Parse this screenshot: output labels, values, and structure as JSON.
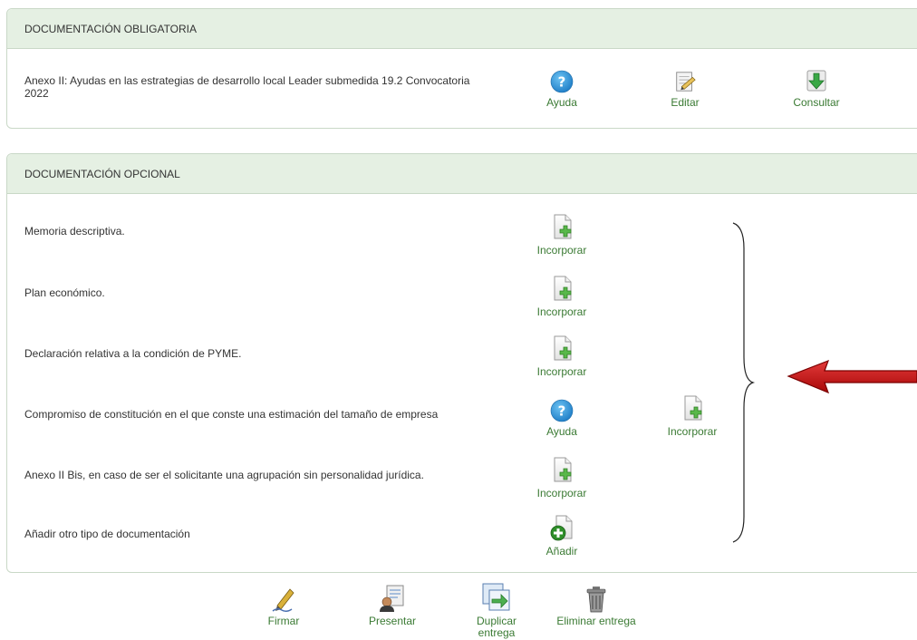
{
  "mandatory": {
    "header": "DOCUMENTACIÓN OBLIGATORIA",
    "doc_line1": "Anexo II: Ayudas en las estrategias de desarrollo local Leader submedida 19.2 Convocatoria",
    "doc_line2": "2022",
    "help_label": "Ayuda",
    "edit_label": "Editar",
    "view_label": "Consultar"
  },
  "optional": {
    "header": "DOCUMENTACIÓN OPCIONAL",
    "items": [
      {
        "label": "Memoria descriptiva.",
        "action": "Incorporar"
      },
      {
        "label": "Plan económico.",
        "action": "Incorporar"
      },
      {
        "label": "Declaración relativa a la condición de PYME.",
        "action": "Incorporar"
      },
      {
        "label": "Compromiso de constitución en el que conste una estimación del tamaño de empresa",
        "help": "Ayuda",
        "action": "Incorporar"
      },
      {
        "label": "Anexo II Bis, en caso de ser el solicitante una agrupación sin personalidad jurídica.",
        "action": "Incorporar"
      },
      {
        "label": "Añadir otro tipo de documentación",
        "action": "Añadir"
      }
    ]
  },
  "footer": {
    "sign": "Firmar",
    "submit": "Presentar",
    "duplicate_line1": "Duplicar",
    "duplicate_line2": "entrega",
    "delete": "Eliminar entrega"
  },
  "colors": {
    "header_bg": "#e5f0e3",
    "link_green": "#3a7a33",
    "help_blue": "#2a8fd4",
    "arrow_red": "#d21010"
  },
  "icons": {
    "help": "question-circle-icon",
    "edit": "notepad-pencil-icon",
    "view": "green-down-arrow-icon",
    "attach": "document-plus-icon",
    "add": "document-round-plus-icon",
    "sign": "pen-icon",
    "submit": "person-document-icon",
    "duplicate": "duplicate-docs-icon",
    "delete": "trash-can-icon"
  }
}
